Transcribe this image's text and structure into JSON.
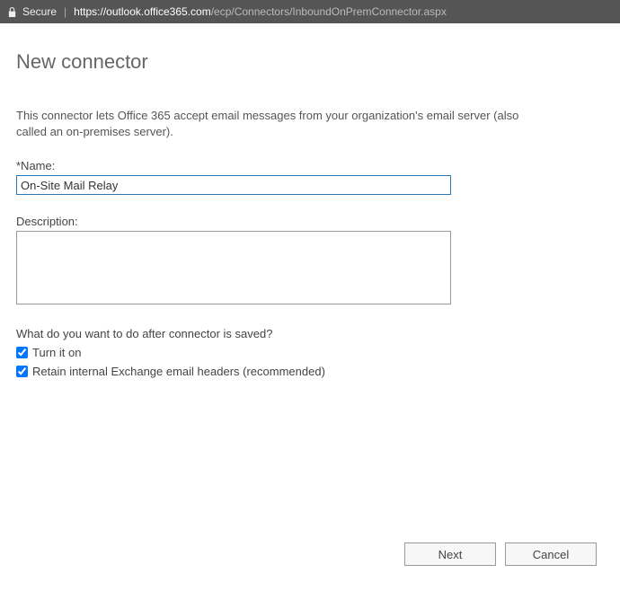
{
  "address_bar": {
    "secure_label": "Secure",
    "url_host": "https://outlook.office365.com",
    "url_path": "/ecp/Connectors/InboundOnPremConnector.aspx"
  },
  "page": {
    "title": "New connector",
    "intro": "This connector lets Office 365 accept email messages from your organization's email server (also called an on-premises server).",
    "name_label": "*Name:",
    "name_value": "On-Site Mail Relay",
    "description_label": "Description:",
    "description_value": "",
    "after_save_question": "What do you want to do after connector is saved?",
    "checkbox_turn_on": "Turn it on",
    "checkbox_retain_headers": "Retain internal Exchange email headers (recommended)"
  },
  "buttons": {
    "next": "Next",
    "cancel": "Cancel"
  }
}
